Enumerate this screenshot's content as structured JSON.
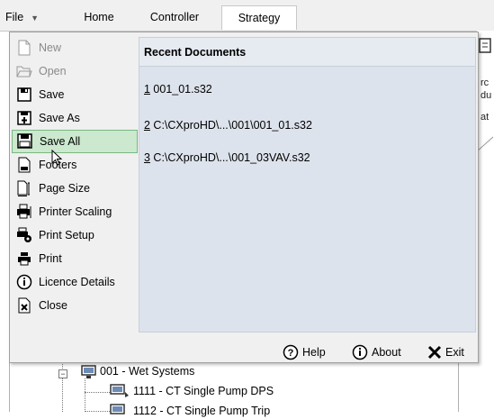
{
  "ribbon": {
    "tabs": [
      {
        "label": "File"
      },
      {
        "label": "Home"
      },
      {
        "label": "Controller"
      },
      {
        "label": "Strategy"
      }
    ]
  },
  "menu": {
    "items": [
      {
        "label": "New",
        "icon": "new-document-icon",
        "disabled": true
      },
      {
        "label": "Open",
        "icon": "open-folder-icon",
        "disabled": true
      },
      {
        "label": "Save",
        "icon": "save-icon",
        "disabled": false
      },
      {
        "label": "Save As",
        "icon": "save-as-icon",
        "disabled": false
      },
      {
        "label": "Save All",
        "icon": "save-all-icon",
        "disabled": false,
        "hover": true
      },
      {
        "label": "Footers",
        "icon": "footers-icon",
        "disabled": false
      },
      {
        "label": "Page Size",
        "icon": "page-size-icon",
        "disabled": false
      },
      {
        "label": "Printer Scaling",
        "icon": "printer-scaling-icon",
        "disabled": false
      },
      {
        "label": "Print Setup",
        "icon": "print-setup-icon",
        "disabled": false
      },
      {
        "label": "Print",
        "icon": "printer-icon",
        "disabled": false
      },
      {
        "label": "Licence Details",
        "icon": "info-icon",
        "disabled": false
      },
      {
        "label": "Close",
        "icon": "close-icon",
        "disabled": false
      }
    ],
    "recent": {
      "title": "Recent Documents",
      "docs": [
        {
          "num": "1",
          "path": " 001_01.s32"
        },
        {
          "num": "2",
          "path": " C:\\CXproHD\\...\\001\\001_01.s32"
        },
        {
          "num": "3",
          "path": " C:\\CXproHD\\...\\001_03VAV.s32"
        }
      ]
    },
    "footer": {
      "help": "Help",
      "about": "About",
      "exit": "Exit"
    }
  },
  "tree": {
    "nodes": [
      {
        "label": "001 - Wet Systems"
      },
      {
        "label": "1111 - CT Single Pump DPS"
      },
      {
        "label": "1112 - CT Single Pump Trip"
      }
    ]
  },
  "background": {
    "glyphs": [
      "rc",
      "du",
      "at"
    ]
  }
}
